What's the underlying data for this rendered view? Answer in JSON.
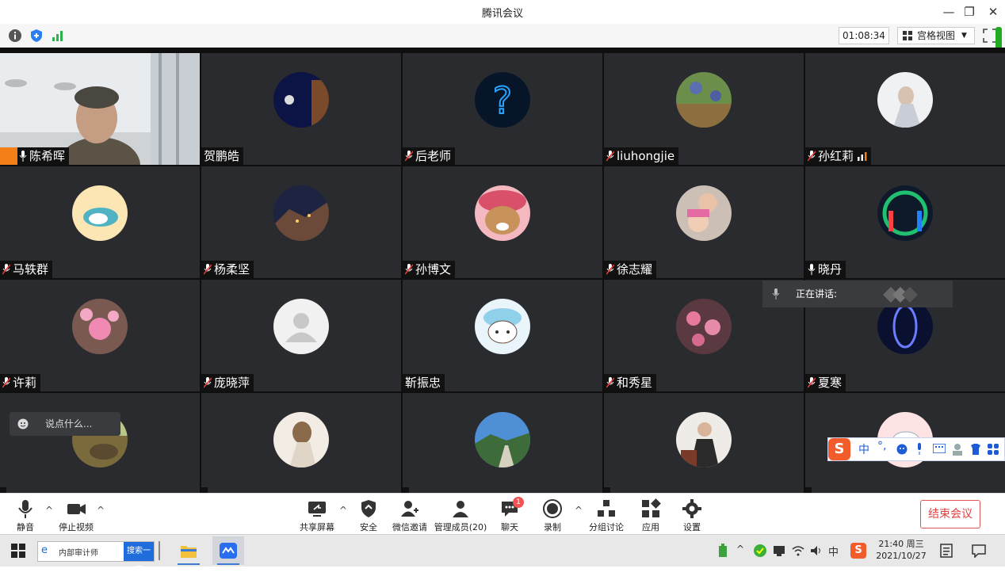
{
  "window": {
    "title": "腾讯会议"
  },
  "toolbar": {
    "timer": "01:08:34",
    "view_label": "宫格视图"
  },
  "participants": [
    {
      "name": "陈希晖",
      "muted": false
    },
    {
      "name": "贺鹏皓",
      "muted": false
    },
    {
      "name": "后老师",
      "muted": true
    },
    {
      "name": "liuhongjie",
      "muted": true
    },
    {
      "name": "孙红莉",
      "muted": true
    },
    {
      "name": "马轶群",
      "muted": true
    },
    {
      "name": "杨柔坚",
      "muted": true
    },
    {
      "name": "孙博文",
      "muted": true
    },
    {
      "name": "徐志耀",
      "muted": true
    },
    {
      "name": "晓丹",
      "muted": false
    },
    {
      "name": "许莉",
      "muted": true
    },
    {
      "name": "庞晓萍",
      "muted": true
    },
    {
      "name": "靳振忠",
      "muted": false
    },
    {
      "name": "和秀星",
      "muted": true
    },
    {
      "name": "夏寒",
      "muted": true
    },
    {
      "name": "",
      "muted": true
    },
    {
      "name": "",
      "muted": true
    },
    {
      "name": "",
      "muted": true
    },
    {
      "name": "",
      "muted": true
    },
    {
      "name": "",
      "muted": true
    }
  ],
  "overlay": {
    "speaking_label": "正在讲话:",
    "chat_placeholder": "说点什么..."
  },
  "controls": {
    "mute": "静音",
    "stop_video": "停止视频",
    "share": "共享屏幕",
    "security": "安全",
    "wechat_invite": "微信邀请",
    "manage_members": "管理成员(20)",
    "chat": "聊天",
    "chat_badge": "1",
    "record": "录制",
    "breakout": "分组讨论",
    "apps": "应用",
    "settings": "设置",
    "end_meeting": "结束会议"
  },
  "ime": {
    "mode": "中"
  },
  "taskbar": {
    "search_text": "内部审计师",
    "search_button": "搜索一下",
    "time": "21:40 周三",
    "date": "2021/10/27",
    "lang": "中"
  },
  "colors": {
    "accent": "#0e6cf2",
    "end": "#e04040",
    "tile_bg": "#2a2b2e"
  }
}
